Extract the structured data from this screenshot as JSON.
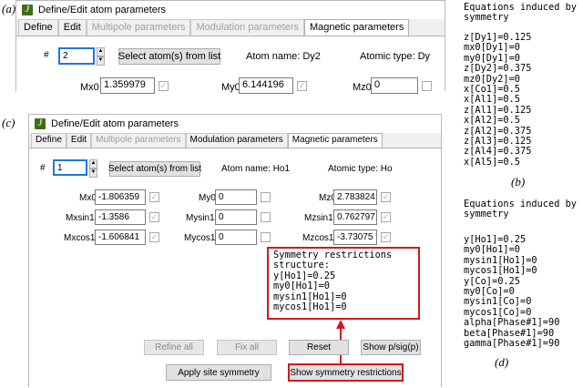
{
  "panel_labels": {
    "a": "(a)",
    "b": "(b)",
    "c": "(c)",
    "d": "(d)"
  },
  "window_a": {
    "title": "Define/Edit atom parameters",
    "tabs": [
      "Define",
      "Edit",
      "Multipole parameters",
      "Modulation parameters",
      "Magnetic parameters"
    ],
    "hash_label": "#",
    "atom_index": "2",
    "select_button": "Select atom(s) from list",
    "atom_name": "Atom name: Dy2",
    "atomic_type": "Atomic type: Dy",
    "fields": [
      {
        "label": "Mx0",
        "value": "1.359979"
      },
      {
        "label": "My0",
        "value": "6.144196"
      },
      {
        "label": "Mz0",
        "value": "0"
      }
    ]
  },
  "window_c": {
    "title": "Define/Edit atom parameters",
    "tabs": [
      "Define",
      "Edit",
      "Multipole parameters",
      "Modulation parameters",
      "Magnetic parameters"
    ],
    "hash_label": "#",
    "atom_index": "1",
    "select_button": "Select atom(s) from list",
    "atom_name": "Atom name: Ho1",
    "atomic_type": "Atomic type: Ho",
    "fields": [
      {
        "label": "Mx0",
        "value": "-1.806359"
      },
      {
        "label": "Mxsin1",
        "value": "-1.3586"
      },
      {
        "label": "Mxcos1",
        "value": "-1.606841"
      },
      {
        "label": "My0",
        "value": "0"
      },
      {
        "label": "Mysin1",
        "value": "0"
      },
      {
        "label": "Mycos1",
        "value": "0"
      },
      {
        "label": "Mz0",
        "value": "2.783824"
      },
      {
        "label": "Mzsin1",
        "value": "0.762797"
      },
      {
        "label": "Mzcos1",
        "value": "-3.73075"
      }
    ],
    "restrictions_title": "Symmetry restrictions\nstructure:",
    "restrictions": [
      "y[Ho1]=0.25",
      "my0[Ho1]=0",
      "mysin1[Ho1]=0",
      "mycos1[Ho1]=0"
    ],
    "buttons": {
      "refine_all": "Refine all",
      "fix_all": "Fix all",
      "reset": "Reset",
      "show_psig": "Show p/sig(p)",
      "apply_site_symmetry": "Apply site symmetry",
      "show_symmetry_restrictions": "Show symmetry restrictions"
    }
  },
  "equations_b": {
    "title": "Equations induced by\nsymmetry",
    "lines": [
      "z[Dy1]=0.125",
      "mx0[Dy1]=0",
      "my0[Dy1]=0",
      "z[Dy2]=0.375",
      "mz0[Dy2]=0",
      "x[Co1]=0.5",
      "x[Al1]=0.5",
      "z[Al1]=0.125",
      "x[Al2]=0.5",
      "z[Al2]=0.375",
      "z[Al3]=0.125",
      "z[Al4]=0.375",
      "x[Al5]=0.5"
    ]
  },
  "equations_d": {
    "title": "Equations induced by\nsymmetry",
    "lines": [
      "y[Ho1]=0.25",
      "my0[Ho1]=0",
      "mysin1[Ho1]=0",
      "mycos1[Ho1]=0",
      "y[Co]=0.25",
      "my0[Co]=0",
      "mysin1[Co]=0",
      "mycos1[Co]=0",
      "alpha[Phase#1]=90",
      "beta[Phase#1]=90",
      "gamma[Phase#1]=90"
    ]
  },
  "colors": {
    "accent_red": "#d01a1a",
    "focus_blue": "#1e78d7"
  }
}
